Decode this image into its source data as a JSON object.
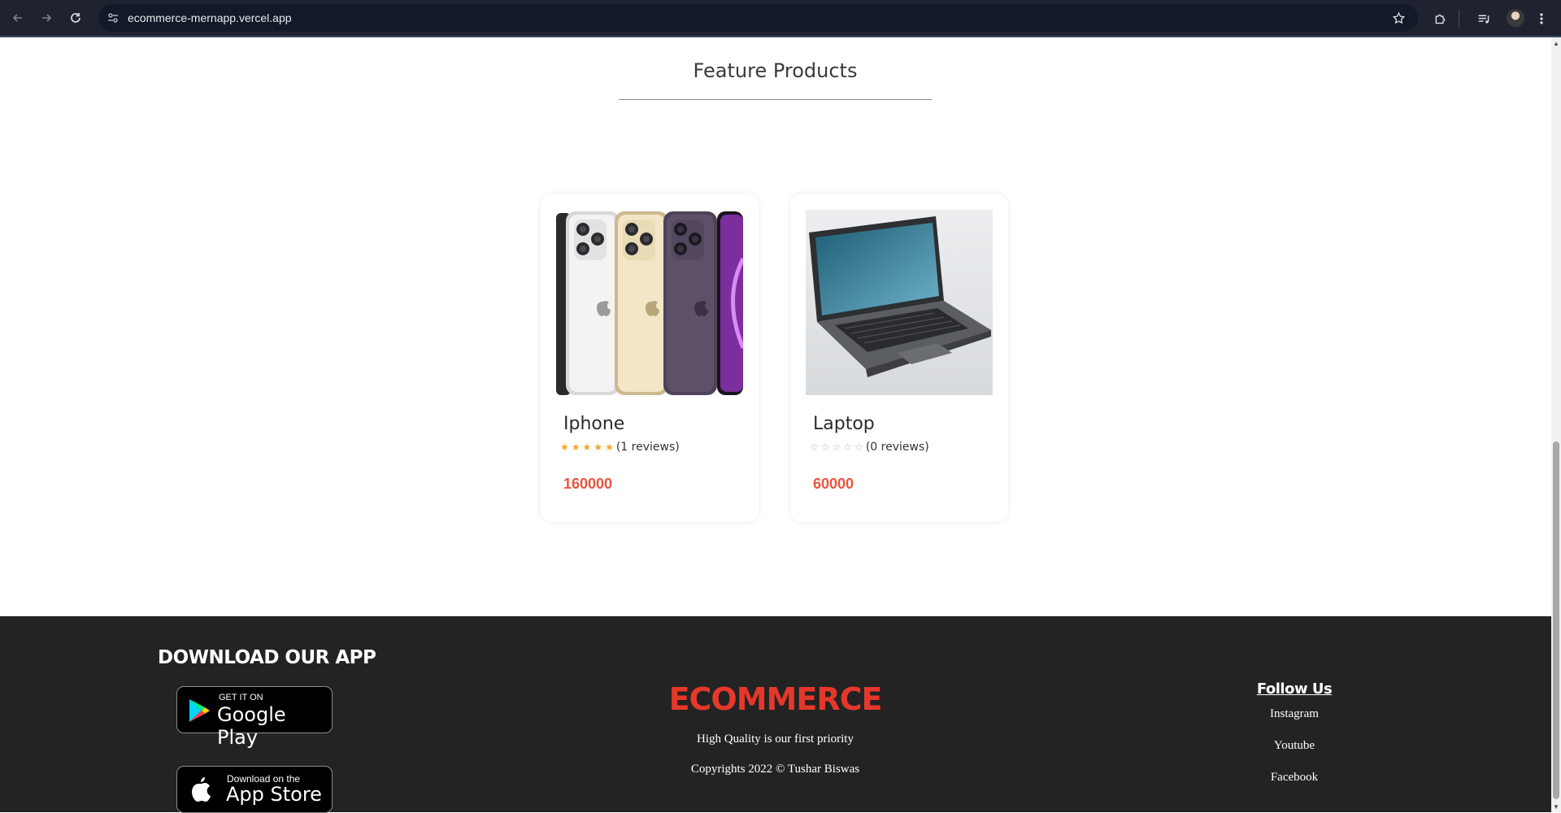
{
  "browser": {
    "url": "ecommerce-mernapp.vercel.app",
    "back_icon": "arrow-left-icon",
    "forward_icon": "arrow-right-icon",
    "reload_icon": "reload-icon"
  },
  "section": {
    "title": "Feature Products"
  },
  "products": [
    {
      "name": "Iphone",
      "rating": 5,
      "max_rating": 5,
      "reviews": "(1 reviews)",
      "price": "160000"
    },
    {
      "name": "Laptop",
      "rating": 0,
      "max_rating": 5,
      "reviews": "(0 reviews)",
      "price": "60000"
    }
  ],
  "footer": {
    "download_title": "DOWNLOAD OUR APP",
    "google_play": {
      "small": "GET IT ON",
      "big": "Google Play"
    },
    "app_store": {
      "small": "Download on the",
      "big": "App Store"
    },
    "brand": "ECOMMERCE",
    "tagline": "High Quality is our first priority",
    "copyright": "Copyrights 2022 © Tushar Biswas",
    "follow_title": "Follow Us",
    "social_links": [
      "Instagram",
      "Youtube",
      "Facebook"
    ]
  },
  "colors": {
    "accent_red": "#e5382a",
    "price": "#e8553e",
    "star": "#f5a623",
    "footer_bg": "#232323"
  }
}
